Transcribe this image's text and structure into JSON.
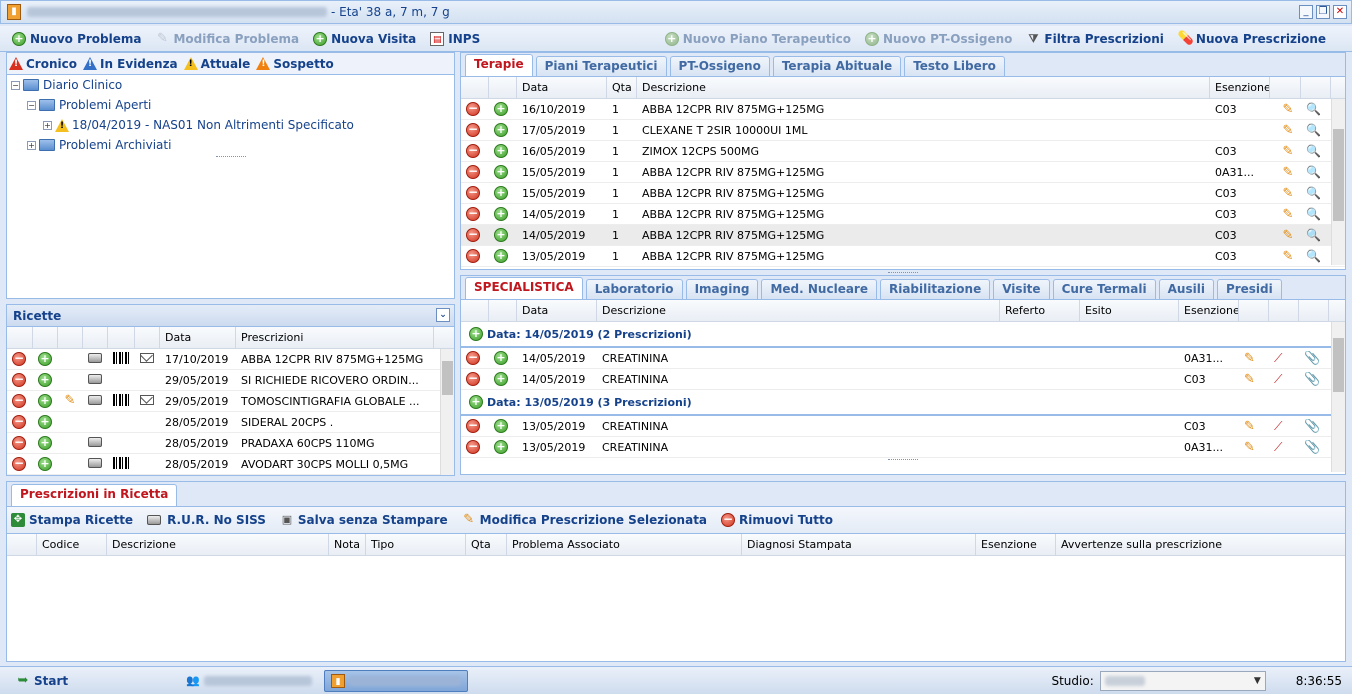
{
  "window": {
    "title_suffix": "- Eta' 38 a, 7 m, 7 g"
  },
  "toolbar": {
    "nuovo_problema": "Nuovo Problema",
    "modifica_problema": "Modifica Problema",
    "nuova_visita": "Nuova Visita",
    "inps": "INPS",
    "nuovo_piano": "Nuovo Piano Terapeutico",
    "nuovo_pt": "Nuovo PT-Ossigeno",
    "filtra": "Filtra Prescrizioni",
    "nuova_prescrizione": "Nuova Prescrizione"
  },
  "legend": {
    "cronico": "Cronico",
    "evidenza": "In Evidenza",
    "attuale": "Attuale",
    "sospetto": "Sospetto"
  },
  "tree": {
    "root": "Diario Clinico",
    "aperti": "Problemi Aperti",
    "problem": "18/04/2019 - NAS01 Non Altrimenti Specificato",
    "archiviati": "Problemi Archiviati"
  },
  "ricette": {
    "title": "Ricette",
    "col_data": "Data",
    "col_prescrizioni": "Prescrizioni",
    "rows": [
      {
        "data": "17/10/2019",
        "desc": "ABBA 12CPR RIV 875MG+125MG"
      },
      {
        "data": "29/05/2019",
        "desc": "SI RICHIEDE RICOVERO ORDIN..."
      },
      {
        "data": "29/05/2019",
        "desc": "TOMOSCINTIGRAFIA GLOBALE ..."
      },
      {
        "data": "28/05/2019",
        "desc": "SIDERAL 20CPS ."
      },
      {
        "data": "28/05/2019",
        "desc": "PRADAXA 60CPS 110MG"
      },
      {
        "data": "28/05/2019",
        "desc": "AVODART 30CPS MOLLI 0,5MG"
      }
    ]
  },
  "terapie": {
    "tabs": [
      "Terapie",
      "Piani Terapeutici",
      "PT-Ossigeno",
      "Terapia Abituale",
      "Testo Libero"
    ],
    "cols": {
      "data": "Data",
      "qta": "Qta",
      "desc": "Descrizione",
      "esenzione": "Esenzione"
    },
    "rows": [
      {
        "data": "16/10/2019",
        "qta": "1",
        "desc": "ABBA 12CPR RIV 875MG+125MG",
        "es": "C03"
      },
      {
        "data": "17/05/2019",
        "qta": "1",
        "desc": "CLEXANE T 2SIR 10000UI 1ML",
        "es": ""
      },
      {
        "data": "16/05/2019",
        "qta": "1",
        "desc": "ZIMOX 12CPS 500MG",
        "es": "C03"
      },
      {
        "data": "15/05/2019",
        "qta": "1",
        "desc": "ABBA 12CPR RIV 875MG+125MG",
        "es": "0A31..."
      },
      {
        "data": "15/05/2019",
        "qta": "1",
        "desc": "ABBA 12CPR RIV 875MG+125MG",
        "es": "C03"
      },
      {
        "data": "14/05/2019",
        "qta": "1",
        "desc": "ABBA 12CPR RIV 875MG+125MG",
        "es": "C03"
      },
      {
        "data": "14/05/2019",
        "qta": "1",
        "desc": "ABBA 12CPR RIV 875MG+125MG",
        "es": "C03"
      },
      {
        "data": "13/05/2019",
        "qta": "1",
        "desc": "ABBA 12CPR RIV 875MG+125MG",
        "es": "C03"
      }
    ]
  },
  "spec": {
    "tabs": [
      "SPECIALISTICA",
      "Laboratorio",
      "Imaging",
      "Med. Nucleare",
      "Riabilitazione",
      "Visite",
      "Cure Termali",
      "Ausili",
      "Presidi"
    ],
    "cols": {
      "data": "Data",
      "desc": "Descrizione",
      "referto": "Referto",
      "esito": "Esito",
      "esenzione": "Esenzione"
    },
    "group1": "Data: 14/05/2019 (2 Prescrizioni)",
    "group2": "Data: 13/05/2019 (3 Prescrizioni)",
    "g1rows": [
      {
        "data": "14/05/2019",
        "desc": "CREATININA",
        "es": "0A31..."
      },
      {
        "data": "14/05/2019",
        "desc": "CREATININA",
        "es": "C03"
      }
    ],
    "g2rows": [
      {
        "data": "13/05/2019",
        "desc": "CREATININA",
        "es": "C03"
      },
      {
        "data": "13/05/2019",
        "desc": "CREATININA",
        "es": "0A31..."
      }
    ]
  },
  "bottom": {
    "tab": "Prescrizioni in Ricetta",
    "stampa": "Stampa Ricette",
    "rur": "R.U.R. No SISS",
    "salva": "Salva senza Stampare",
    "modifica": "Modifica Prescrizione Selezionata",
    "rimuovi": "Rimuovi Tutto",
    "cols": {
      "codice": "Codice",
      "descrizione": "Descrizione",
      "nota": "Nota",
      "tipo": "Tipo",
      "qta": "Qta",
      "problema": "Problema Associato",
      "diagnosi": "Diagnosi Stampata",
      "esenzione": "Esenzione",
      "avvertenze": "Avvertenze sulla prescrizione"
    }
  },
  "taskbar": {
    "start": "Start",
    "studio_label": "Studio:",
    "time": "8:36:55"
  }
}
